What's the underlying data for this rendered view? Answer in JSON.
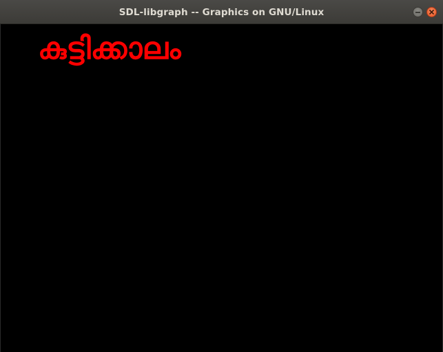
{
  "window": {
    "title": "SDL-libgraph -- Graphics on GNU/Linux",
    "buttons": {
      "minimize_icon": "minimize-icon",
      "close_icon": "close-icon"
    }
  },
  "canvas": {
    "background_color": "#000000",
    "text": "കുട്ടിക്കാലം",
    "text_color": "#ff0000"
  }
}
